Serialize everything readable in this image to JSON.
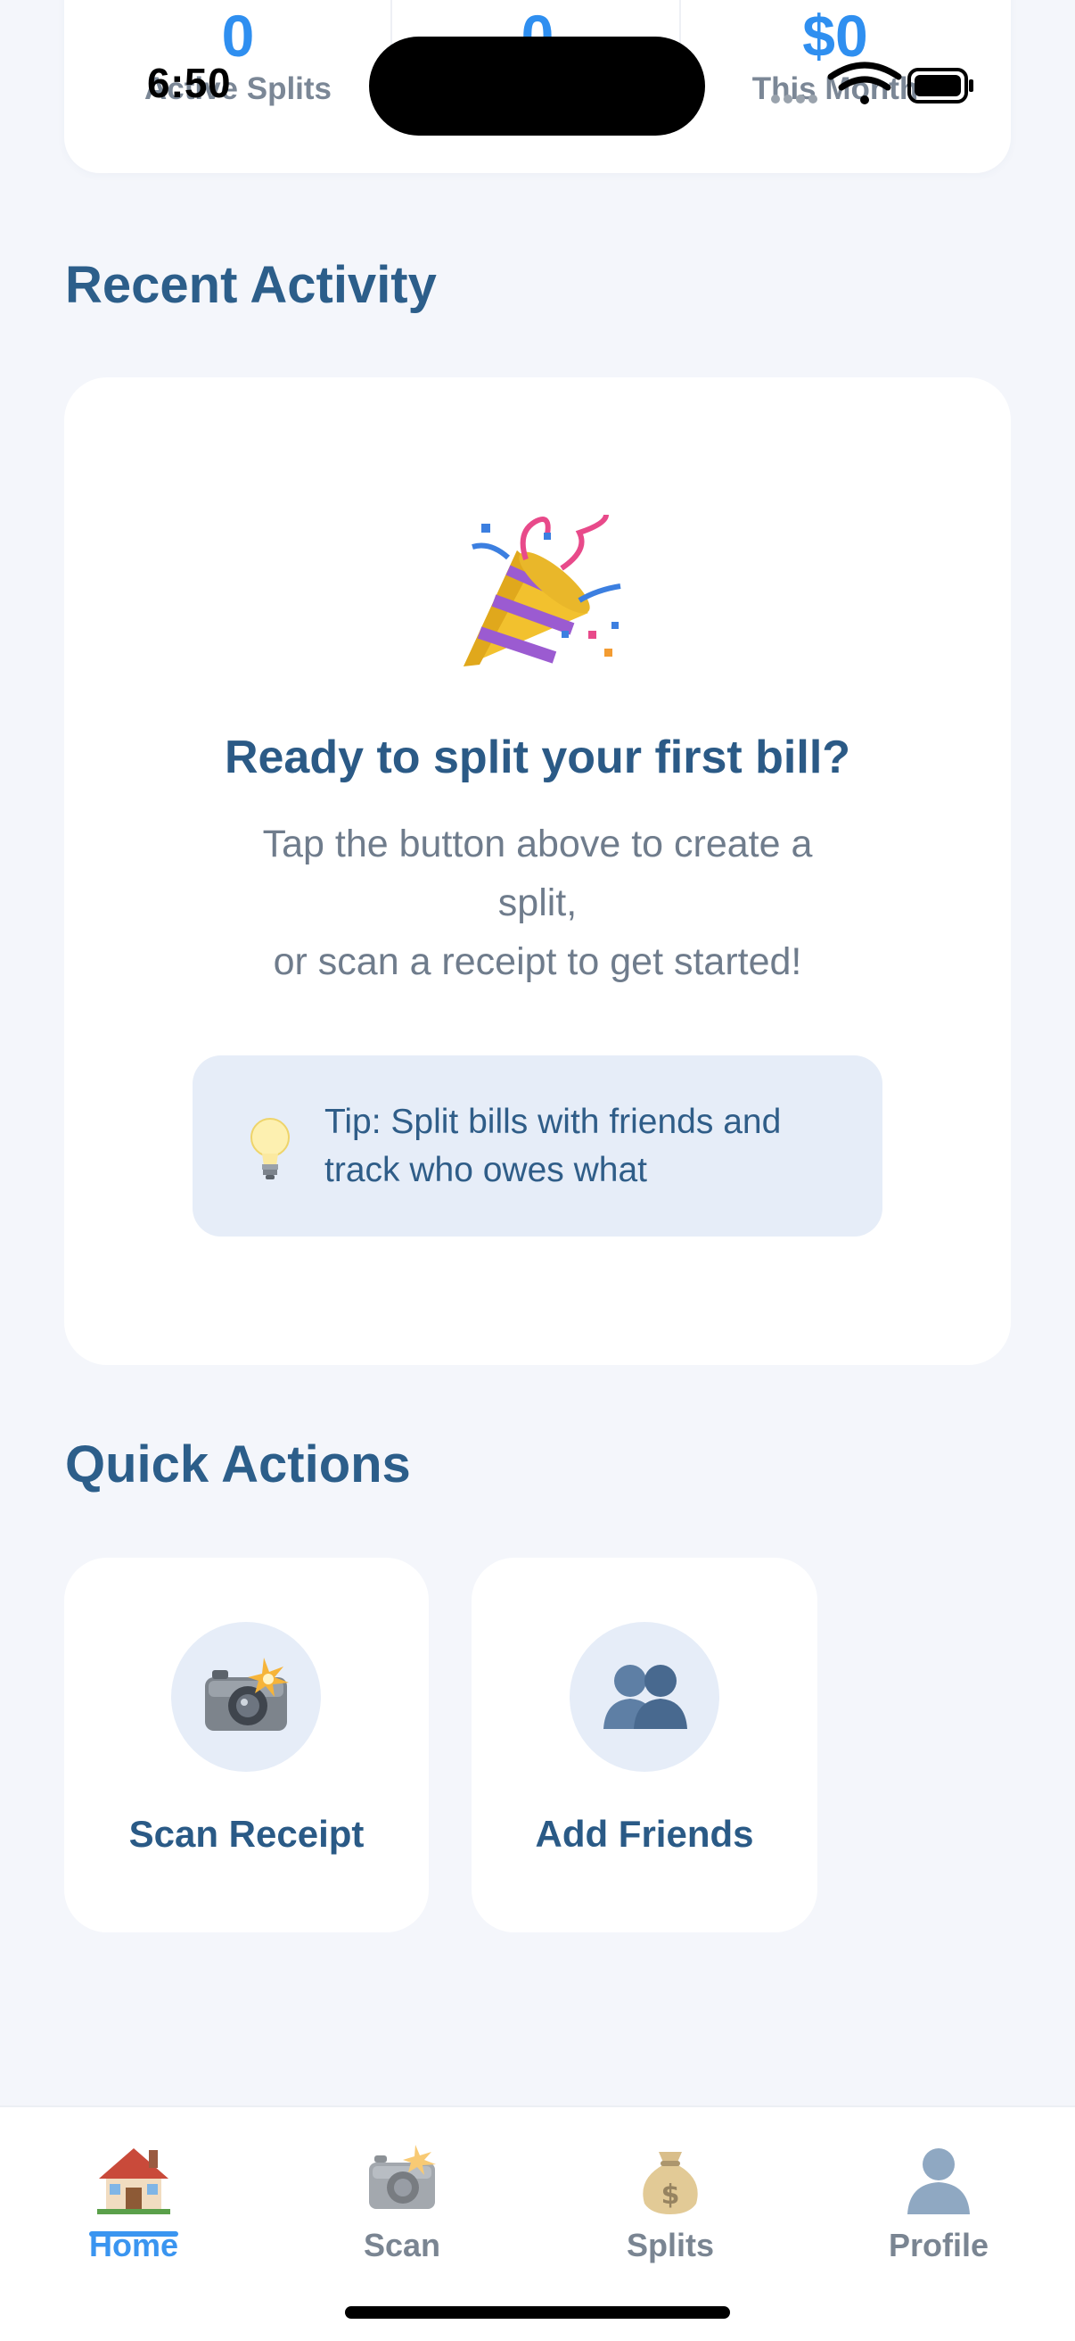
{
  "status_bar": {
    "time": "6:50"
  },
  "stats": [
    {
      "value": "0",
      "label": "Active Splits"
    },
    {
      "value": "0",
      "label": ""
    },
    {
      "value": "$0",
      "label": "This Month"
    }
  ],
  "recent_activity": {
    "title": "Recent Activity",
    "empty_icon": "party-popper-icon",
    "empty_title": "Ready to split your first bill?",
    "empty_body": "Tap the button above to create a\nsplit,\nor scan a receipt to get started!",
    "tip_icon": "lightbulb-icon",
    "tip_text": "Tip: Split bills with friends and track who owes what"
  },
  "quick_actions": {
    "title": "Quick Actions",
    "items": [
      {
        "icon": "camera-flash-icon",
        "label": "Scan Receipt"
      },
      {
        "icon": "friends-icon",
        "label": "Add Friends"
      }
    ]
  },
  "tab_bar": {
    "items": [
      {
        "icon": "house-icon",
        "label": "Home",
        "active": true
      },
      {
        "icon": "camera-flash-icon",
        "label": "Scan",
        "active": false
      },
      {
        "icon": "money-bag-icon",
        "label": "Splits",
        "active": false
      },
      {
        "icon": "person-silhouette-icon",
        "label": "Profile",
        "active": false
      }
    ]
  },
  "colors": {
    "background": "#f4f6fb",
    "card": "#ffffff",
    "accent": "#3a95f0",
    "title": "#2c5e8a",
    "muted": "#7a8592",
    "tint": "#e6edf8"
  }
}
